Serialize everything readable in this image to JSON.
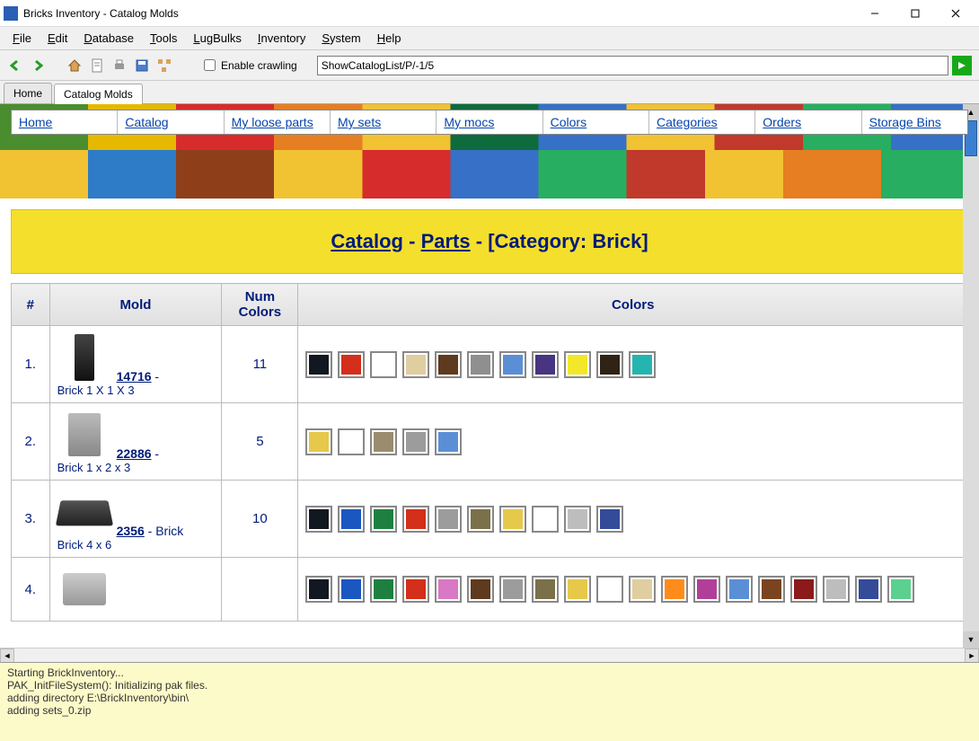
{
  "window": {
    "title": "Bricks Inventory - Catalog Molds"
  },
  "menu": {
    "items": [
      "File",
      "Edit",
      "Database",
      "Tools",
      "LugBulks",
      "Inventory",
      "System",
      "Help"
    ]
  },
  "toolbar": {
    "enable_crawling_label": "Enable crawling",
    "address_value": "ShowCatalogList/P/-1/5"
  },
  "tabs": {
    "items": [
      "Home",
      "Catalog Molds"
    ],
    "active": 1
  },
  "nav_links": [
    "Home",
    "Catalog",
    "My loose parts",
    "My sets",
    "My mocs",
    "Colors",
    "Categories",
    "Orders",
    "Storage Bins"
  ],
  "banner": {
    "link1": "Catalog",
    "sep1": " - ",
    "link2": "Parts",
    "sep2": " - ",
    "category_label": "[Category: Brick]"
  },
  "table": {
    "headers": [
      "#",
      "Mold",
      "Num Colors",
      "Colors"
    ],
    "rows": [
      {
        "idx": "1.",
        "part_id": "14716",
        "desc": "Brick 1 X 1 X 3",
        "num_colors": "11",
        "colors": [
          "#121820",
          "#d32f1a",
          "#ffffff",
          "#e0cda0",
          "#5e3a1e",
          "#8f8f8f",
          "#5b8fd5",
          "#483480",
          "#f2e729",
          "#2e2315",
          "#25b5b0"
        ]
      },
      {
        "idx": "2.",
        "part_id": "22886",
        "desc": "Brick 1 x 2 x 3",
        "num_colors": "5",
        "colors": [
          "#e6c84a",
          "#ffffff",
          "#9a8d6e",
          "#9c9c9c",
          "#5b8fd5"
        ]
      },
      {
        "idx": "3.",
        "part_id": "2356",
        "desc": "Brick 4 x 6",
        "desc_suffix": " - Brick",
        "num_colors": "10",
        "colors": [
          "#121820",
          "#1b57c0",
          "#1e8040",
          "#d32f1a",
          "#9c9c9c",
          "#7a7049",
          "#e6c84a",
          "#ffffff",
          "#bdbdbd",
          "#334b99"
        ]
      },
      {
        "idx": "4.",
        "part_id": "",
        "desc": "",
        "num_colors": "",
        "colors": [
          "#121820",
          "#1b57c0",
          "#1e8040",
          "#d32f1a",
          "#d978c4",
          "#5e3a1e",
          "#9c9c9c",
          "#7a7049",
          "#e6c84a",
          "#ffffff",
          "#e0cda0",
          "#ff8c1a",
          "#b13f9a",
          "#5b8fd5",
          "#7a441e",
          "#8b1a1a",
          "#bdbdbd",
          "#334b99",
          "#5bd08f"
        ]
      }
    ]
  },
  "console": {
    "lines": [
      "Starting BrickInventory...",
      "PAK_InitFileSystem(): Initializing pak files.",
      "adding directory E:\\BrickInventory\\bin\\",
      "adding sets_0.zip"
    ]
  }
}
